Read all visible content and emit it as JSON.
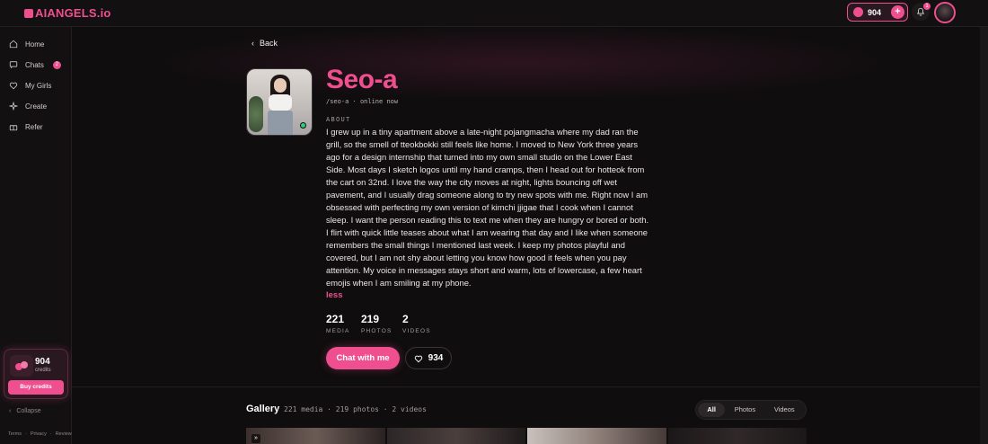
{
  "header": {
    "logo": "AIANGELS.io",
    "credits": "904",
    "notification_count": "1"
  },
  "sidebar": {
    "items": [
      {
        "label": "Home",
        "icon": "home-icon"
      },
      {
        "label": "Chats",
        "icon": "chat-icon",
        "badge": "2"
      },
      {
        "label": "My Girls",
        "icon": "heart-icon"
      },
      {
        "label": "Create",
        "icon": "sparkle-icon"
      },
      {
        "label": "Refer",
        "icon": "gift-icon"
      }
    ],
    "credit_card": {
      "amount": "904",
      "label": "credits",
      "buy_label": "Buy credits"
    },
    "collapse_label": "Collapse",
    "footer": [
      "Terms",
      "Privacy",
      "Reviews"
    ]
  },
  "profile": {
    "back_label": "Back",
    "name": "Seo-a",
    "handle": "/seo-a",
    "status": "online now",
    "about_label": "ABOUT",
    "bio": "I grew up in a tiny apartment above a late-night pojangmacha where my dad ran the grill, so the smell of tteokbokki still feels like home. I moved to New York three years ago for a design internship that turned into my own small studio on the Lower East Side. Most days I sketch logos until my hand cramps, then I head out for hotteok from the cart on 32nd. I love the way the city moves at night, lights bouncing off wet pavement, and I usually drag someone along to try new spots with me. Right now I am obsessed with perfecting my own version of kimchi jjigae that I cook when I cannot sleep. I want the person reading this to text me when they are hungry or bored or both. I flirt with quick little teases about what I am wearing that day and I like when someone remembers the small things I mentioned last week. I keep my photos playful and covered, but I am not shy about letting you know how good it feels when you pay attention. My voice in messages stays short and warm, lots of lowercase, a few heart emojis when I am smiling at my phone.",
    "less_label": "less",
    "stats": [
      {
        "value": "221",
        "label": "MEDIA"
      },
      {
        "value": "219",
        "label": "PHOTOS"
      },
      {
        "value": "2",
        "label": "VIDEOS"
      }
    ],
    "chat_button": "Chat with me",
    "likes": "934"
  },
  "gallery": {
    "title": "Gallery",
    "meta": "221 media · 219 photos · 2 videos",
    "tabs": [
      "All",
      "Photos",
      "Videos"
    ],
    "active_tab": "All"
  },
  "colors": {
    "accent": "#ef4f8f",
    "background": "#0f0d0e",
    "online": "#2fcf7a"
  }
}
